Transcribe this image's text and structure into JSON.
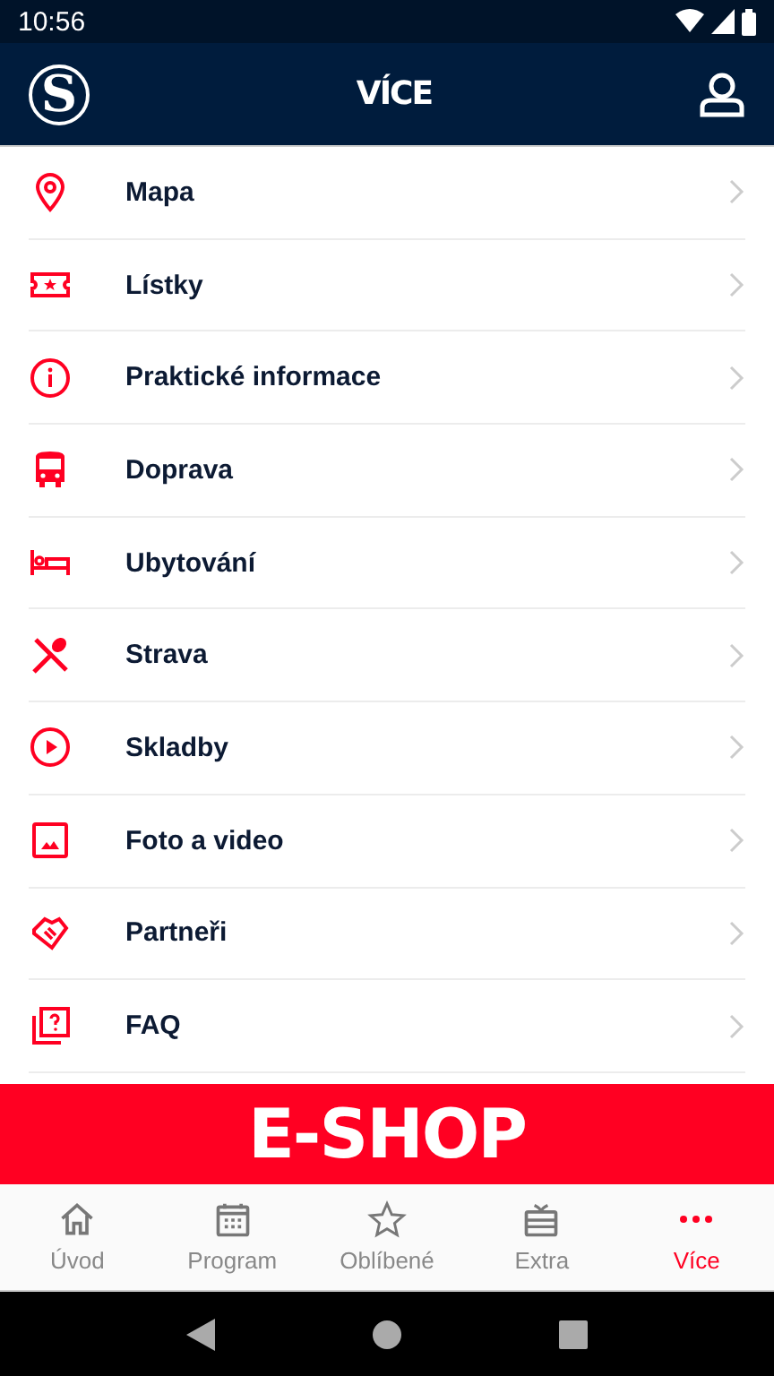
{
  "status_bar": {
    "time": "10:56"
  },
  "header": {
    "logo_text": "S",
    "title": "VÍCE"
  },
  "menu": [
    {
      "label": "Mapa"
    },
    {
      "label": "Lístky"
    },
    {
      "label": "Praktické informace"
    },
    {
      "label": "Doprava"
    },
    {
      "label": "Ubytování"
    },
    {
      "label": "Strava"
    },
    {
      "label": "Skladby"
    },
    {
      "label": "Foto a video"
    },
    {
      "label": "Partneři"
    },
    {
      "label": "FAQ"
    }
  ],
  "banner": {
    "label": "E-SHOP"
  },
  "bottom_nav": [
    {
      "label": "Úvod",
      "selected": false
    },
    {
      "label": "Program",
      "selected": false
    },
    {
      "label": "Oblíbené",
      "selected": false
    },
    {
      "label": "Extra",
      "selected": false
    },
    {
      "label": "Více",
      "selected": true
    }
  ]
}
